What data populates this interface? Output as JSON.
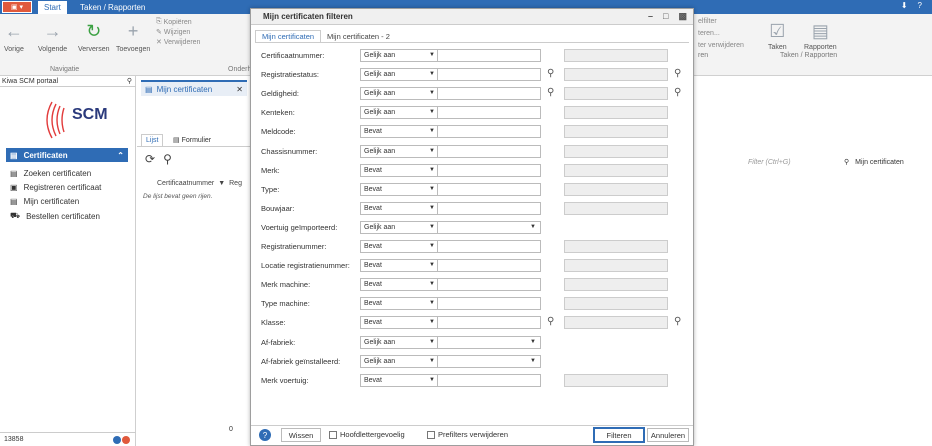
{
  "topbar": {
    "tabs": [
      "Start",
      "Taken / Rapporten"
    ],
    "right_icons": [
      "⬇",
      "?"
    ]
  },
  "ribbon": {
    "nav": [
      "Vorige",
      "Volgende",
      "Verversen",
      "Toevoegen"
    ],
    "small": [
      "Kopiëren",
      "Wijzigen",
      "Verwijderen"
    ],
    "group_labels": [
      "Navigatie",
      "Onderh"
    ],
    "right_filters": [
      "elfilter",
      "teren...",
      "ter verwijderen",
      "ren"
    ],
    "right_groups": [
      "Taken",
      "Rapporten"
    ],
    "right_group_label": "Taken / Rapporten"
  },
  "left": {
    "portal": "Kiwa SCM portaal",
    "logo_text": "SCM",
    "header": "Certificaten",
    "items": [
      "Zoeken certificaten",
      "Registreren certificaat",
      "Mijn certificaten",
      "Bestellen certificaten"
    ],
    "footer_count": "13858"
  },
  "middle": {
    "doc_tab": "Mijn certificaten",
    "sub_tabs": [
      "Lijst",
      "Formulier"
    ],
    "column": "Certificaatnummer",
    "column2": "Reg",
    "empty": "De lijst bevat geen rijen.",
    "count": "0"
  },
  "right": {
    "filter_placeholder": "Filter (Ctrl+G)",
    "filter_dropdown": "Mijn certificaten"
  },
  "modal": {
    "title": "Mijn certificaten filteren",
    "tabs": [
      "Mijn certificaten",
      "Mijn certificaten - 2"
    ],
    "rows": [
      {
        "label": "Certificaatnummer:",
        "op": "Gelijk aan",
        "type": "text"
      },
      {
        "label": "Registratiestatus:",
        "op": "Gelijk aan",
        "type": "search"
      },
      {
        "label": "Geldigheid:",
        "op": "Gelijk aan",
        "type": "search"
      },
      {
        "label": "Kenteken:",
        "op": "Gelijk aan",
        "type": "text"
      },
      {
        "label": "Meldcode:",
        "op": "Bevat",
        "type": "text"
      },
      {
        "label": "Chassisnummer:",
        "op": "Gelijk aan",
        "type": "text"
      },
      {
        "label": "Merk:",
        "op": "Bevat",
        "type": "text"
      },
      {
        "label": "Type:",
        "op": "Bevat",
        "type": "text"
      },
      {
        "label": "Bouwjaar:",
        "op": "Bevat",
        "type": "text"
      },
      {
        "label": "Voertuig geïmporteerd:",
        "op": "Gelijk aan",
        "type": "dropdown"
      },
      {
        "label": "Registratienummer:",
        "op": "Bevat",
        "type": "text"
      },
      {
        "label": "Locatie registratienummer:",
        "op": "Bevat",
        "type": "text"
      },
      {
        "label": "Merk machine:",
        "op": "Bevat",
        "type": "text"
      },
      {
        "label": "Type machine:",
        "op": "Bevat",
        "type": "text"
      },
      {
        "label": "Klasse:",
        "op": "Bevat",
        "type": "search"
      },
      {
        "label": "Af-fabriek:",
        "op": "Gelijk aan",
        "type": "dropdown"
      },
      {
        "label": "Af-fabriek geïnstalleerd:",
        "op": "Gelijk aan",
        "type": "dropdown"
      },
      {
        "label": "Merk voertuig:",
        "op": "Bevat",
        "type": "text"
      }
    ],
    "footer": {
      "wissen": "Wissen",
      "case": "Hoofdlettergevoelig",
      "prefilters": "Prefilters verwijderen",
      "filter": "Filteren",
      "cancel": "Annuleren"
    }
  }
}
